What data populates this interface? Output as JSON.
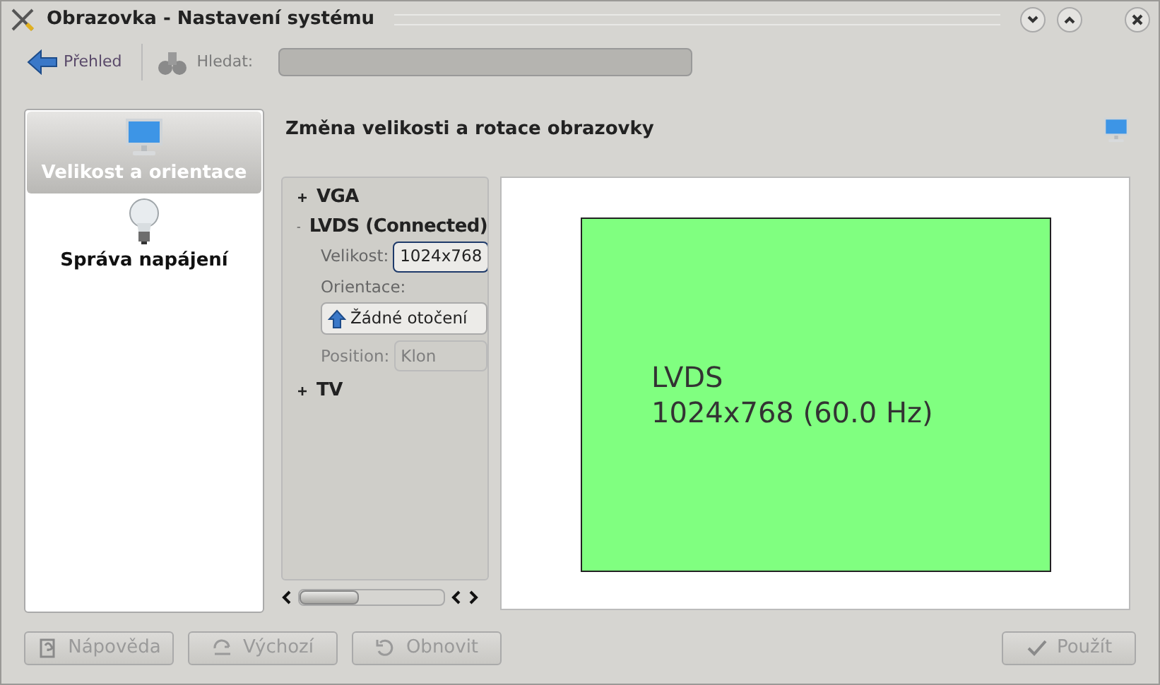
{
  "window": {
    "title": "Obrazovka - Nastavení systému"
  },
  "toolbar": {
    "back": {
      "label": "Přehled",
      "disabled": false
    },
    "search": {
      "label": "Hledat:",
      "disabled": true
    }
  },
  "sidebar": {
    "items": [
      {
        "label": "Velikost a orientace",
        "selected": true
      },
      {
        "label": "Správa napájení",
        "selected": false
      }
    ]
  },
  "page": {
    "title": "Změna velikosti a rotace obrazovky"
  },
  "outputs": [
    {
      "name": "VGA",
      "expanded": false
    },
    {
      "name": "LVDS (Connected)",
      "expanded": true,
      "size_label": "Velikost:",
      "size_value": "1024x768",
      "orientation_label": "Orientace:",
      "orientation_value": "Žádné otočení",
      "position_label": "Position:",
      "position_value": "Klon"
    },
    {
      "name": "TV",
      "expanded": false
    }
  ],
  "preview": {
    "name": "LVDS",
    "mode": "1024x768 (60.0 Hz)"
  },
  "buttons": [
    {
      "label": "Nápověda",
      "disabled": true
    },
    {
      "label": "Výchozí",
      "disabled": true
    },
    {
      "label": "Obnovit",
      "disabled": true
    },
    {
      "label": "Použít",
      "disabled": true
    }
  ]
}
